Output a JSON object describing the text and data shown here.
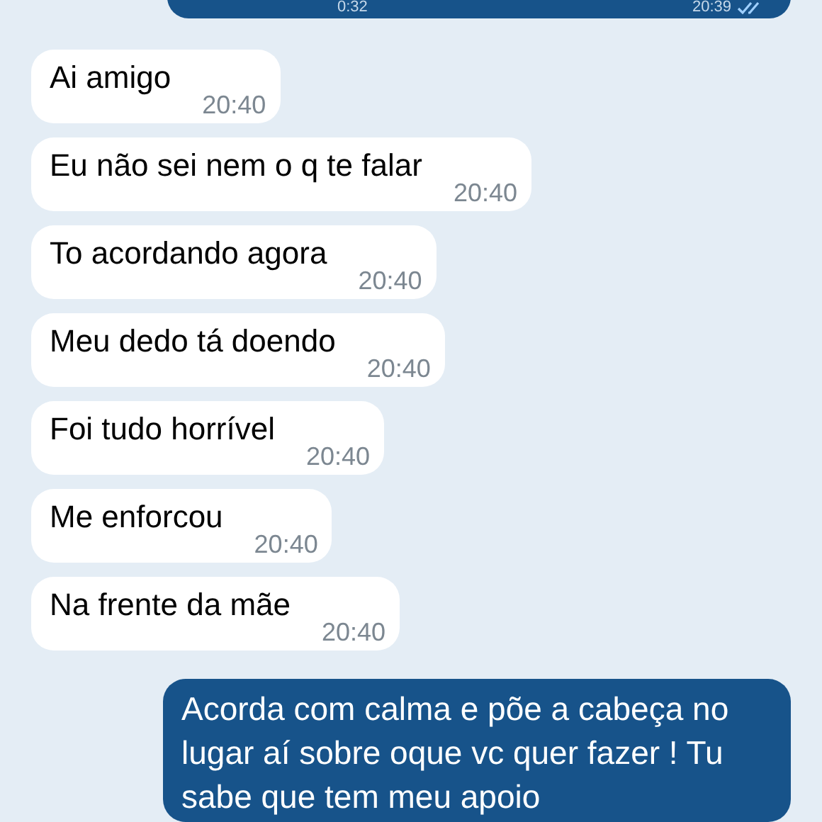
{
  "messages": [
    {
      "kind": "voice",
      "outgoing": true,
      "duration": "0:32",
      "time": "20:39",
      "read": true
    },
    {
      "kind": "text",
      "outgoing": false,
      "text": "Ai amigo",
      "time": "20:40"
    },
    {
      "kind": "text",
      "outgoing": false,
      "text": "Eu não sei nem o q te falar",
      "time": "20:40"
    },
    {
      "kind": "text",
      "outgoing": false,
      "text": "To acordando agora",
      "time": "20:40"
    },
    {
      "kind": "text",
      "outgoing": false,
      "text": "Meu dedo tá doendo",
      "time": "20:40"
    },
    {
      "kind": "text",
      "outgoing": false,
      "text": "Foi tudo horrível",
      "time": "20:40"
    },
    {
      "kind": "text",
      "outgoing": false,
      "text": "Me enforcou",
      "time": "20:40"
    },
    {
      "kind": "text",
      "outgoing": false,
      "text": "Na frente da mãe",
      "time": "20:40"
    },
    {
      "kind": "text",
      "outgoing": true,
      "text": "Acorda com calma e põe a cabeça no lugar aí sobre oque vc quer fazer ! Tu sabe que tem meu apoio"
    }
  ]
}
